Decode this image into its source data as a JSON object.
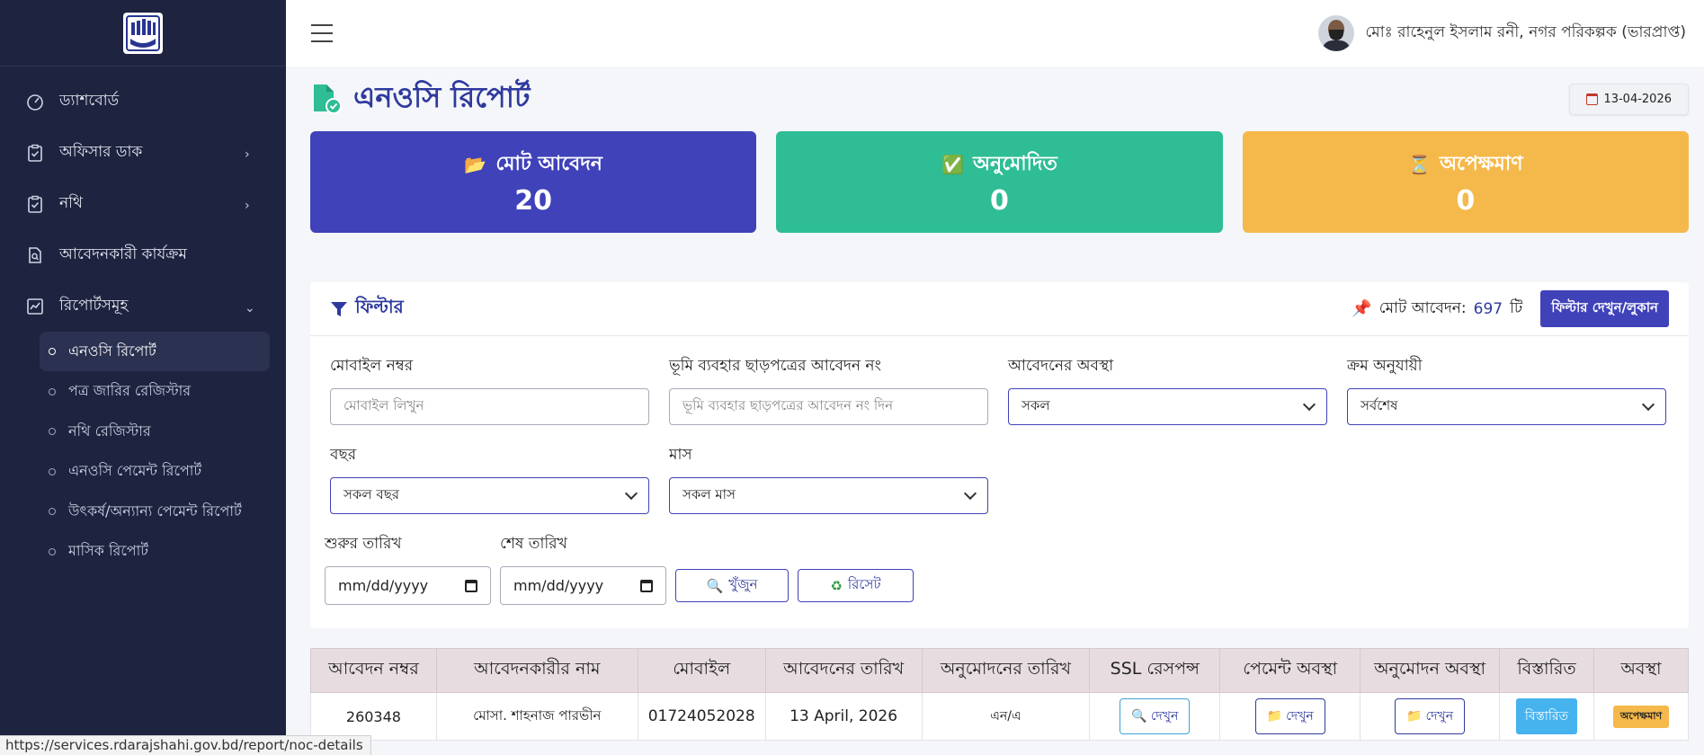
{
  "sidebar": {
    "items": [
      {
        "label": "ড্যাশবোর্ড",
        "icon": "gauge-icon",
        "chevron": ""
      },
      {
        "label": "অফিসার ডাক",
        "icon": "clipboard-check-icon",
        "chevron": "›"
      },
      {
        "label": "নথি",
        "icon": "clipboard-check-icon",
        "chevron": "›"
      },
      {
        "label": "আবেদনকারী কার্যক্রম",
        "icon": "file-search-icon",
        "chevron": ""
      },
      {
        "label": "রিপোর্টসমূহ",
        "icon": "chart-line-icon",
        "chevron": "⌄"
      }
    ],
    "sub_items": [
      {
        "label": "এনওসি রিপোর্ট",
        "active": true
      },
      {
        "label": "পত্র জারির রেজিস্টার",
        "active": false
      },
      {
        "label": "নথি রেজিস্টার",
        "active": false
      },
      {
        "label": "এনওসি পেমেন্ট রিপোর্ট",
        "active": false
      },
      {
        "label": "উৎকর্ষ/অন্যান্য পেমেন্ট রিপোর্ট",
        "active": false
      },
      {
        "label": "মাসিক রিপোর্ট",
        "active": false
      }
    ]
  },
  "header": {
    "user_name": "মোঃ রাহেনুল ইসলাম রনী, নগর পরিকল্পক (ভারপ্রাপ্ত)"
  },
  "page": {
    "title": "এনওসি রিপোর্ট",
    "date": "13-04-2026"
  },
  "cards": [
    {
      "title": "মোট আবেদন",
      "value": "20",
      "emoji": "📂",
      "color": "#3f42b8"
    },
    {
      "title": "অনুমোদিত",
      "value": "0",
      "emoji": "✅",
      "color": "#2ebd95"
    },
    {
      "title": "অপেক্ষমাণ",
      "value": "0",
      "emoji": "⏳",
      "color": "#f5b84a"
    }
  ],
  "filter": {
    "title": "ফিল্টার",
    "count_label": "মোট আবেদন:",
    "count_value": "697",
    "count_suffix": "টি",
    "toggle_label": "ফিল্টার দেখুন/লুকান",
    "mobile": {
      "label": "মোবাইল নম্বর",
      "placeholder": "মোবাইল লিখুন"
    },
    "land_use": {
      "label": "ভূমি ব্যবহার ছাড়পত্রের আবেদন নং",
      "placeholder": "ভূমি ব্যবহার ছাড়পত্রের আবেদন নং দিন"
    },
    "status": {
      "label": "আবেদনের অবস্থা",
      "value": "সকল"
    },
    "order": {
      "label": "ক্রম অনুযায়ী",
      "value": "সর্বশেষ"
    },
    "year": {
      "label": "বছর",
      "value": "সকল বছর"
    },
    "month": {
      "label": "মাস",
      "value": "সকল মাস"
    },
    "start_date": {
      "label": "শুরুর তারিখ",
      "value": "mm/dd/yyyy"
    },
    "end_date": {
      "label": "শেষ তারিখ",
      "value": "mm/dd/yyyy"
    },
    "search_label": "খুঁজুন",
    "reset_label": "রিসেট"
  },
  "table": {
    "columns": [
      "আবেদন নম্বর",
      "আবেদনকারীর নাম",
      "মোবাইল",
      "আবেদনের তারিখ",
      "অনুমোদনের তারিখ",
      "SSL রেসপন্স",
      "পেমেন্ট অবস্থা",
      "অনুমোদন অবস্থা",
      "বিস্তারিত",
      "অবস্থা"
    ],
    "rows": [
      {
        "id": "260348",
        "name": "মোসা. শাহনাজ পারভীন",
        "mobile": "01724052028",
        "applied": "13 April, 2026",
        "approved": "এন/এ",
        "ssl": "দেখুন",
        "payment": "দেখুন",
        "approval": "দেখুন",
        "details": "বিস্তারিত",
        "status": "অপেক্ষমাণ"
      }
    ]
  },
  "statusbar": {
    "url": "https://services.rdarajshahi.gov.bd/report/noc-details"
  }
}
